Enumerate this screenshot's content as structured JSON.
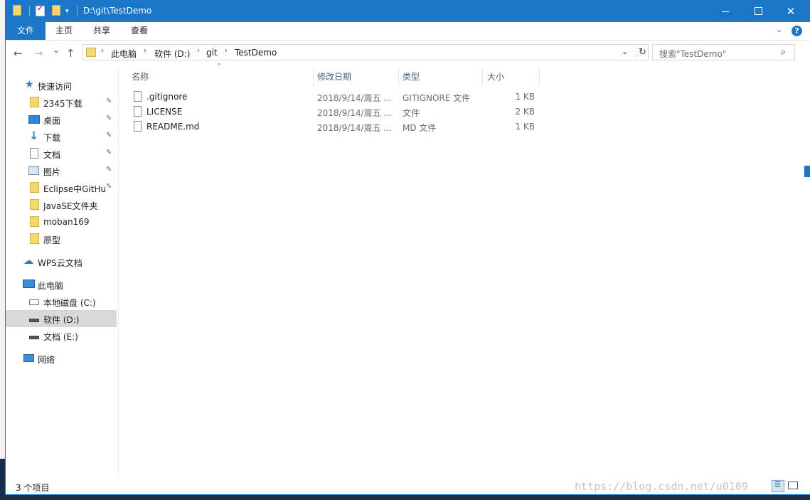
{
  "window": {
    "title": "D:\\git\\TestDemo",
    "controls": {
      "minimize": "minimize",
      "maximize": "maximize",
      "close": "✕"
    }
  },
  "ribbon": {
    "tabs": [
      {
        "label": "文件"
      },
      {
        "label": "主页"
      },
      {
        "label": "共享"
      },
      {
        "label": "查看"
      }
    ],
    "expand_icon": "chevron-down-icon",
    "help_glyph": "?"
  },
  "navigation": {
    "back": "←",
    "forward": "→",
    "recent": "⌄",
    "up": "↑"
  },
  "address": {
    "segments": [
      "此电脑",
      "软件 (D:)",
      "git",
      "TestDemo"
    ],
    "separator": "›",
    "dropdown": "⌄",
    "refresh": "↻"
  },
  "search": {
    "placeholder": "搜索\"TestDemo\"",
    "icon": "⌕"
  },
  "nav_pane": {
    "items": [
      {
        "label": "快速访问",
        "icon": "star-icon",
        "pinned": false,
        "selected": false
      },
      {
        "label": "2345下载",
        "icon": "folder-icon",
        "pinned": true,
        "selected": false
      },
      {
        "label": "桌面",
        "icon": "desktop-icon",
        "pinned": true,
        "selected": false
      },
      {
        "label": "下载",
        "icon": "download-icon",
        "pinned": true,
        "selected": false
      },
      {
        "label": "文档",
        "icon": "document-icon",
        "pinned": true,
        "selected": false
      },
      {
        "label": "图片",
        "icon": "picture-icon",
        "pinned": true,
        "selected": false
      },
      {
        "label": "Eclipse中GitHub",
        "icon": "folder-icon",
        "pinned": true,
        "selected": false
      },
      {
        "label": "JavaSE文件夹",
        "icon": "folder-icon",
        "pinned": false,
        "selected": false
      },
      {
        "label": "moban169",
        "icon": "folder-icon",
        "pinned": false,
        "selected": false
      },
      {
        "label": "原型",
        "icon": "folder-icon",
        "pinned": false,
        "selected": false
      },
      {
        "label": "WPS云文档",
        "icon": "cloud-icon",
        "pinned": false,
        "selected": false
      },
      {
        "label": "此电脑",
        "icon": "computer-icon",
        "pinned": false,
        "selected": false
      },
      {
        "label": "本地磁盘 (C:)",
        "icon": "drive-c-icon",
        "pinned": false,
        "selected": false
      },
      {
        "label": "软件 (D:)",
        "icon": "drive-icon",
        "pinned": false,
        "selected": true
      },
      {
        "label": "文档 (E:)",
        "icon": "drive-icon",
        "pinned": false,
        "selected": false
      },
      {
        "label": "网络",
        "icon": "network-icon",
        "pinned": false,
        "selected": false
      }
    ],
    "pin_glyph": "📌"
  },
  "file_list": {
    "columns": [
      "名称",
      "修改日期",
      "类型",
      "大小"
    ],
    "sort_indicator": "^",
    "rows": [
      {
        "name": ".gitignore",
        "date": "2018/9/14/周五 ...",
        "type": "GITIGNORE 文件",
        "size": "1 KB"
      },
      {
        "name": "LICENSE",
        "date": "2018/9/14/周五 ...",
        "type": "文件",
        "size": "2 KB"
      },
      {
        "name": "README.md",
        "date": "2018/9/14/周五 ...",
        "type": "MD 文件",
        "size": "1 KB"
      }
    ]
  },
  "status": {
    "item_count": "3 个项目",
    "watermark": "https://blog.csdn.net/u0109"
  },
  "colors": {
    "accent": "#1c76c6",
    "selection": "#d9d9d9",
    "folder": "#f7d774"
  }
}
